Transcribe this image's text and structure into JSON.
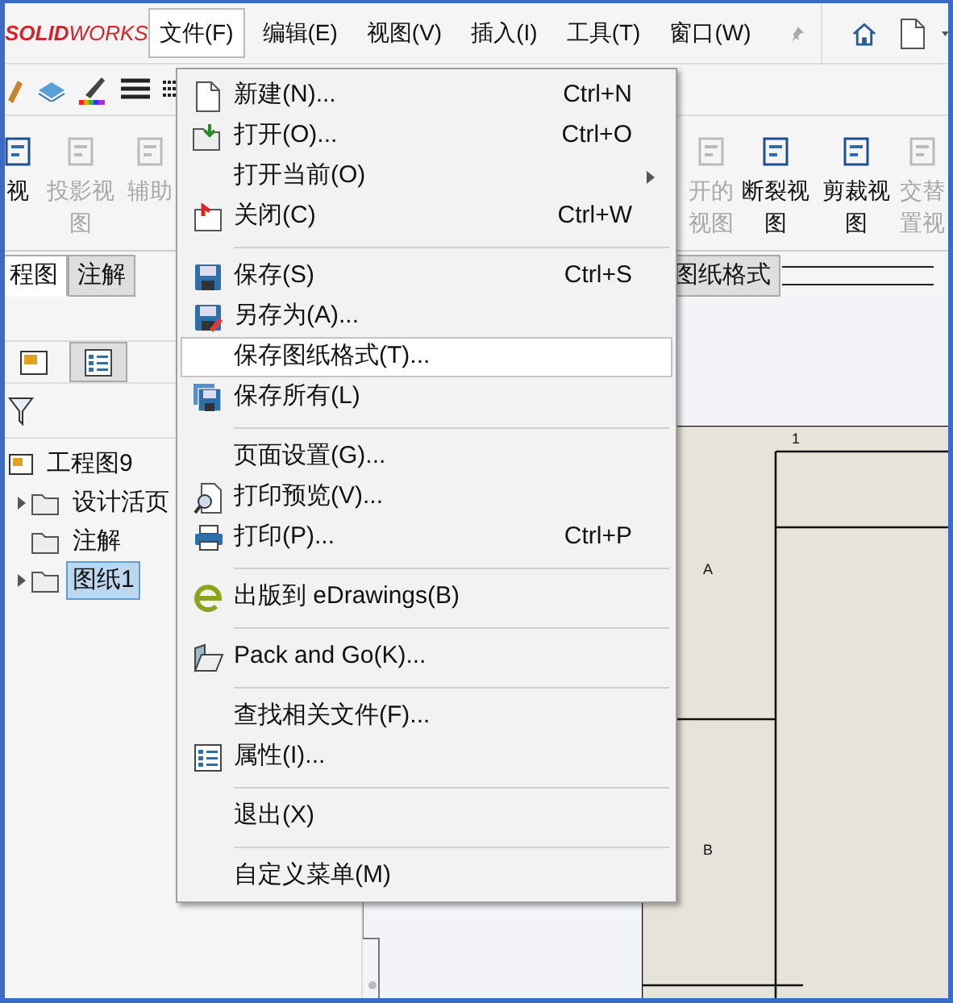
{
  "app": {
    "logo": "**SOLID**WORKS"
  },
  "menubar": [
    {
      "label": "文件(F)",
      "selected": true
    },
    {
      "label": "编辑(E)",
      "selected": false
    },
    {
      "label": "视图(V)",
      "selected": false
    },
    {
      "label": "插入(I)",
      "selected": false
    },
    {
      "label": "工具(T)",
      "selected": false
    },
    {
      "label": "窗口(W)",
      "selected": false
    }
  ],
  "commands_left": [
    {
      "lines": [
        "视"
      ],
      "disabled": false
    },
    {
      "lines": [
        "投影视",
        "图"
      ],
      "disabled": true
    },
    {
      "lines": [
        "辅助"
      ],
      "disabled": true
    }
  ],
  "commands_right": [
    {
      "lines": [
        "开的",
        "视图"
      ],
      "disabled": true
    },
    {
      "lines": [
        "断裂视",
        "图"
      ],
      "disabled": false
    },
    {
      "lines": [
        "剪裁视",
        "图"
      ],
      "disabled": false
    },
    {
      "lines": [
        "交替",
        "置视"
      ],
      "disabled": true
    }
  ],
  "tabs_left": [
    {
      "label": "程图",
      "selected": true
    },
    {
      "label": "注解",
      "selected": false
    }
  ],
  "tabs_right": [
    {
      "label": "图纸格式",
      "selected": false
    }
  ],
  "panel_tabs": [
    {
      "selected": false
    },
    {
      "selected": true
    }
  ],
  "tree": [
    {
      "label": "工程图9",
      "selected": false,
      "children": [
        {
          "label": "设计活页",
          "expandable": true,
          "selected": false
        },
        {
          "label": "注解",
          "expandable": false,
          "selected": false
        },
        {
          "label": "图纸1",
          "expandable": true,
          "selected": true
        }
      ]
    }
  ],
  "sheet": {
    "zone_number": "1",
    "zone_rows": [
      "A",
      "B"
    ]
  },
  "file_menu": [
    {
      "kind": "item",
      "label": "新建(N)...",
      "shortcut": "Ctrl+N",
      "submenu": false,
      "selected": false
    },
    {
      "kind": "item",
      "label": "打开(O)...",
      "shortcut": "Ctrl+O",
      "submenu": false,
      "selected": false
    },
    {
      "kind": "item",
      "label": "打开当前(O)",
      "submenu": true,
      "selected": false
    },
    {
      "kind": "item",
      "label": "关闭(C)",
      "shortcut": "Ctrl+W",
      "submenu": false,
      "selected": false
    },
    {
      "kind": "separator"
    },
    {
      "kind": "item",
      "label": "保存(S)",
      "shortcut": "Ctrl+S",
      "submenu": false,
      "selected": false
    },
    {
      "kind": "item",
      "label": "另存为(A)...",
      "submenu": false,
      "selected": false
    },
    {
      "kind": "item",
      "label": "保存图纸格式(T)...",
      "submenu": false,
      "selected": true
    },
    {
      "kind": "item",
      "label": "保存所有(L)",
      "submenu": false,
      "selected": false
    },
    {
      "kind": "separator"
    },
    {
      "kind": "item",
      "label": "页面设置(G)...",
      "submenu": false,
      "selected": false
    },
    {
      "kind": "item",
      "label": "打印预览(V)...",
      "submenu": false,
      "selected": false
    },
    {
      "kind": "item",
      "label": "打印(P)...",
      "shortcut": "Ctrl+P",
      "submenu": false,
      "selected": false
    },
    {
      "kind": "separator"
    },
    {
      "kind": "item",
      "label": "出版到 eDrawings(B)",
      "submenu": false,
      "selected": false
    },
    {
      "kind": "separator"
    },
    {
      "kind": "item",
      "label": "Pack and Go(K)...",
      "submenu": false,
      "selected": false
    },
    {
      "kind": "separator"
    },
    {
      "kind": "item",
      "label": "查找相关文件(F)...",
      "submenu": false,
      "selected": false
    },
    {
      "kind": "item",
      "label": "属性(I)...",
      "submenu": false,
      "selected": false
    },
    {
      "kind": "separator"
    },
    {
      "kind": "item",
      "label": "退出(X)",
      "submenu": false,
      "selected": false
    },
    {
      "kind": "separator"
    },
    {
      "kind": "item",
      "label": "自定义菜单(M)",
      "submenu": false,
      "selected": false
    }
  ]
}
